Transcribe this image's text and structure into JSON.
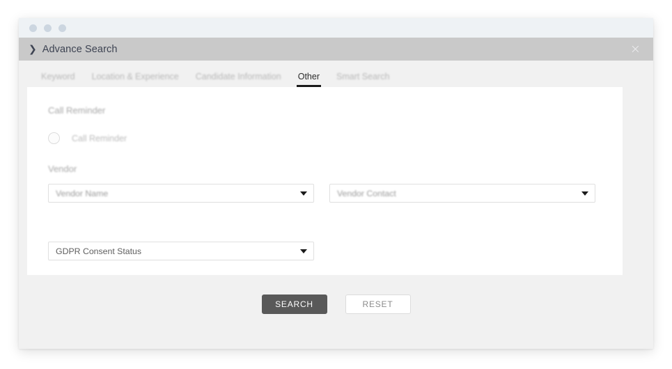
{
  "window": {
    "dots": [
      "dot-1",
      "dot-2",
      "dot-3"
    ],
    "header": {
      "chevron_icon": "chevron-right-icon",
      "title": "Advance Search",
      "close_icon": "×"
    }
  },
  "tabs": [
    {
      "label": "Keyword",
      "active": false
    },
    {
      "label": "Location & Experience",
      "active": false
    },
    {
      "label": "Candidate Information",
      "active": false
    },
    {
      "label": "Other",
      "active": true
    },
    {
      "label": "Smart Search",
      "active": false
    }
  ],
  "form": {
    "call_reminder": {
      "section_label": "Call Reminder",
      "radio_label": "Call Reminder",
      "radio_checked": false
    },
    "vendor": {
      "section_label": "Vendor",
      "vendor_name": {
        "value": "Vendor Name",
        "caret_icon": "caret-down-icon"
      },
      "vendor_contact": {
        "value": "Vendor Contact",
        "caret_icon": "caret-down-icon"
      }
    },
    "gdpr": {
      "value": "GDPR Consent Status",
      "caret_icon": "caret-down-icon"
    }
  },
  "footer": {
    "search_label": "SEARCH",
    "reset_label": "RESET"
  },
  "colors": {
    "titlebar": "#eef2f5",
    "headerbar": "#c9c9c9",
    "body": "#f1f1f1",
    "card": "#ffffff",
    "active_tab_underline": "#1a1a1a",
    "search_button": "#595959",
    "dot": "#ccd6e0"
  }
}
